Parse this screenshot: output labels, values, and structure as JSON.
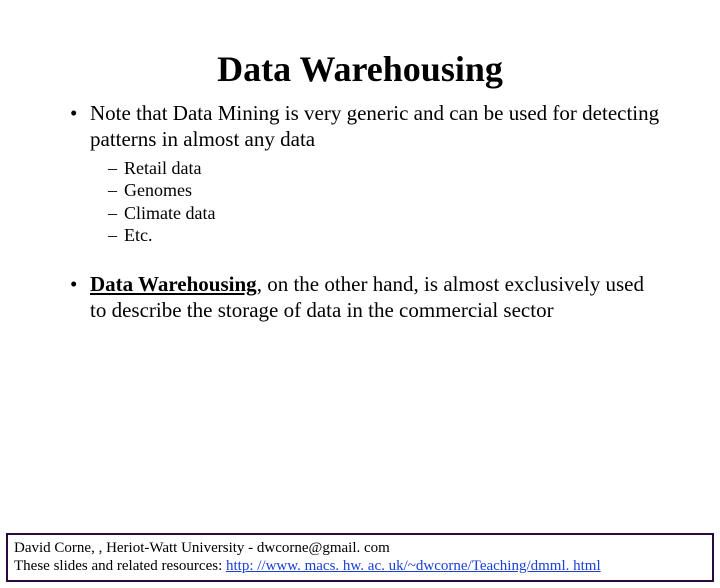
{
  "title": "Data Warehousing",
  "bullets": {
    "b1": "Note that Data Mining is very generic and can be used for detecting patterns in almost any data",
    "sub": {
      "s1": "Retail data",
      "s2": "Genomes",
      "s3": "Climate data",
      "s4": "Etc."
    },
    "b2_strong": "Data Warehousing",
    "b2_rest": ", on the other hand, is almost exclusively used to describe the storage of data in the commercial sector"
  },
  "footer": {
    "line1": "David Corne, ,  Heriot-Watt University  -  dwcorne@gmail. com",
    "line2_prefix": "These slides and related resources:  ",
    "line2_link": "http: //www. macs. hw. ac. uk/~dwcorne/Teaching/dmml. html"
  }
}
